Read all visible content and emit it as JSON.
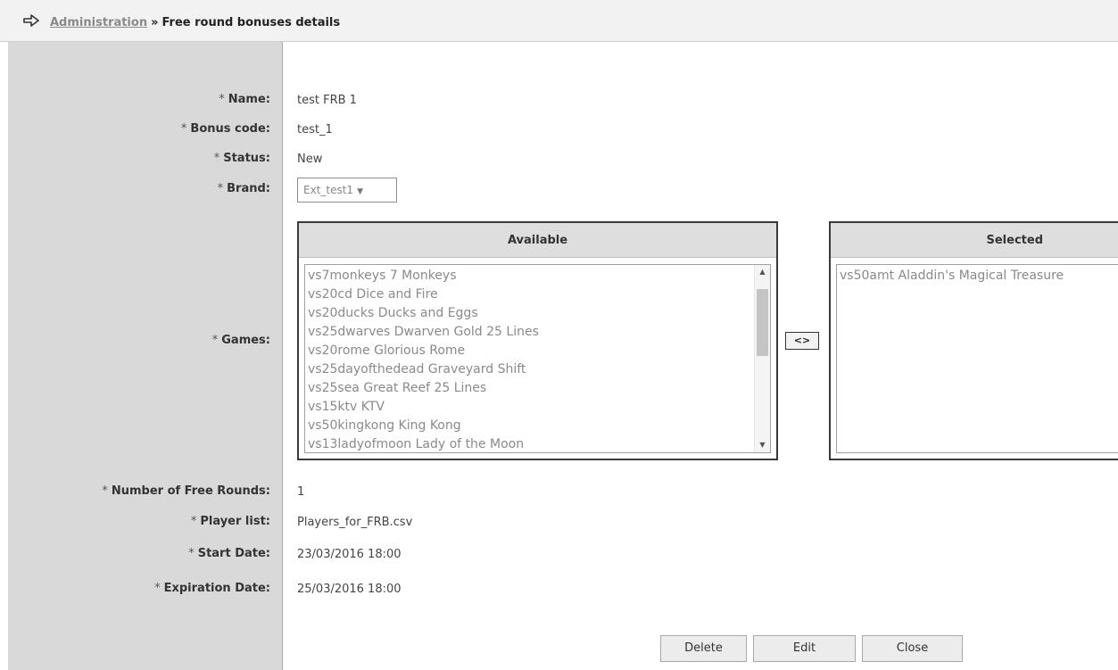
{
  "header": {
    "breadcrumb_link": "Administration",
    "separator": "»",
    "title": "Free round bonuses details",
    "icon": "arrow-right-icon"
  },
  "form": {
    "required_marker": "*",
    "name": {
      "label": "Name:",
      "value": "test FRB 1"
    },
    "bonus_code": {
      "label": "Bonus code:",
      "value": "test_1"
    },
    "status": {
      "label": "Status:",
      "value": "New"
    },
    "brand": {
      "label": "Brand:",
      "value": "Ext_test1"
    },
    "games": {
      "label": "Games:",
      "available_header": "Available",
      "selected_header": "Selected",
      "available": [
        "vs7monkeys 7 Monkeys",
        "vs20cd Dice and Fire",
        "vs20ducks Ducks and Eggs",
        "vs25dwarves Dwarven Gold 25 Lines",
        "vs20rome Glorious Rome",
        "vs25dayofthedead Graveyard Shift",
        "vs25sea Great Reef 25 Lines",
        "vs15ktv KTV",
        "vs50kingkong King Kong",
        "vs13ladyofmoon Lady of the Moon"
      ],
      "selected": [
        "vs50amt Aladdin's Magical Treasure"
      ],
      "move_label": "<>"
    },
    "free_rounds": {
      "label": "Number of Free Rounds:",
      "value": "1"
    },
    "player_list": {
      "label": "Player list:",
      "value": "Players_for_FRB.csv"
    },
    "start_date": {
      "label": "Start Date:",
      "value": "23/03/2016 18:00"
    },
    "expiration_date": {
      "label": "Expiration Date:",
      "value": "25/03/2016 18:00"
    }
  },
  "actions": {
    "delete": "Delete",
    "edit": "Edit",
    "close": "Close"
  }
}
